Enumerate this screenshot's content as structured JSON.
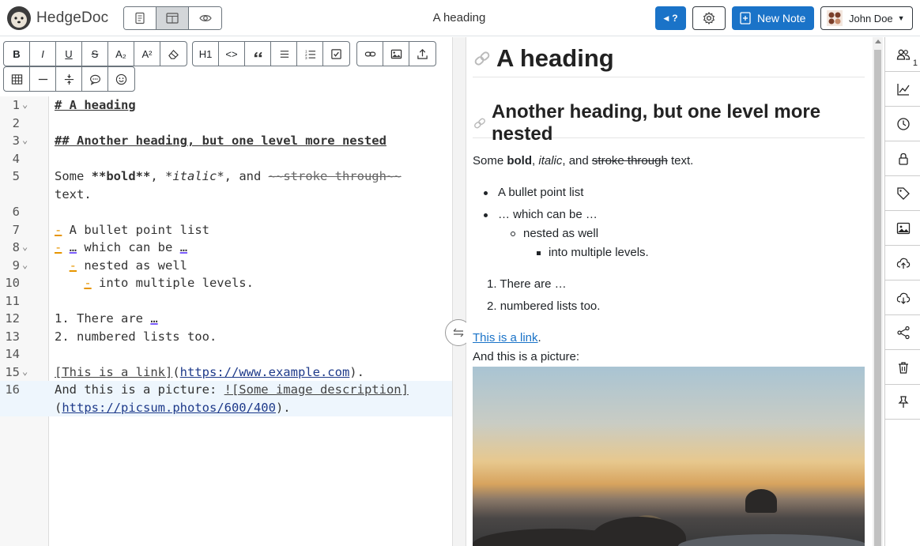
{
  "app": {
    "brand": "HedgeDoc",
    "note_title": "A heading"
  },
  "header": {
    "view_modes": [
      {
        "name": "editor",
        "icon": "file-text-icon",
        "active": false
      },
      {
        "name": "split",
        "icon": "split-view-icon",
        "active": true
      },
      {
        "name": "preview",
        "icon": "eye-icon",
        "active": false
      }
    ],
    "help_label": "?",
    "new_note_label": "New Note",
    "user_name": "John Doe"
  },
  "toolbar": {
    "row1": [
      [
        "B",
        "I",
        "U",
        "S",
        "A₂",
        "A²",
        "eraser"
      ],
      [
        "H1",
        "<>",
        "quote",
        "list",
        "ordered-list",
        "checklist"
      ],
      [
        "link",
        "image",
        "upload"
      ]
    ],
    "row2": [
      [
        "table",
        "horizontal-rule",
        "collapsible",
        "comment",
        "emoji"
      ]
    ],
    "labels": {
      "bold": "B",
      "italic": "I",
      "underline": "U",
      "strike": "S",
      "subscript": "A₂",
      "superscript": "A²",
      "h1": "H1",
      "code": "<>"
    }
  },
  "editor": {
    "lines": [
      {
        "n": "1",
        "fold": true
      },
      {
        "n": "2",
        "fold": false
      },
      {
        "n": "3",
        "fold": true
      },
      {
        "n": "4",
        "fold": false
      },
      {
        "n": "5",
        "fold": false
      },
      {
        "n": "6",
        "fold": false
      },
      {
        "n": "7",
        "fold": false
      },
      {
        "n": "8",
        "fold": true
      },
      {
        "n": "9",
        "fold": true
      },
      {
        "n": "10",
        "fold": false
      },
      {
        "n": "11",
        "fold": false
      },
      {
        "n": "12",
        "fold": false
      },
      {
        "n": "13",
        "fold": false
      },
      {
        "n": "14",
        "fold": false
      },
      {
        "n": "15",
        "fold": true
      },
      {
        "n": "16",
        "fold": false
      }
    ],
    "text": {
      "l1": "# A heading",
      "l3": "## Another heading, but one level more nested",
      "l5a": "Some ",
      "l5b": "**bold**",
      "l5c": ", ",
      "l5d": "*italic*",
      "l5e": ", and ",
      "l5f": "~~stroke through~~",
      "l5g": "text.",
      "l7a": "-",
      "l7b": " A bullet point list",
      "l8a": "-",
      "l8b": "…",
      "l8c": " which can be ",
      "l8d": "…",
      "l9a": "-",
      "l9b": " nested as well",
      "l10a": "-",
      "l10b": " into multiple levels.",
      "l12a": "1. There are ",
      "l12b": "…",
      "l13": "2. numbered lists too.",
      "l15a": "[This is a link]",
      "l15b": "(",
      "l15c": "https://www.example.com",
      "l15d": ").",
      "l16a": "And this is a picture: ",
      "l16b": "![Some image description]",
      "l16c": "(",
      "l16d": "https://picsum.photos/600/400",
      "l16e": ")."
    }
  },
  "preview": {
    "h1": "A heading",
    "h2": "Another heading, but one level more nested",
    "p1": {
      "a": "Some ",
      "bold": "bold",
      "b": ", ",
      "italic": "italic",
      "c": ", and ",
      "strike": "stroke through",
      "d": " text."
    },
    "bullets": [
      "A bullet point list",
      "… which can be …",
      "nested as well",
      "into multiple levels."
    ],
    "numbered": [
      {
        "n": "1.",
        "text": "There are …"
      },
      {
        "n": "2.",
        "text": "numbered lists too."
      }
    ],
    "link_text": "This is a link",
    "link_after": ".",
    "picture_caption": "And this is a picture:"
  },
  "sidebar": {
    "items": [
      "users-icon",
      "chart-icon",
      "history-icon",
      "lock-icon",
      "tag-icon",
      "image-icon",
      "cloud-upload-icon",
      "cloud-download-icon",
      "share-icon",
      "trash-icon",
      "pin-icon"
    ],
    "online_count": "1"
  },
  "colors": {
    "primary": "#1a73c8",
    "accent_orange": "#e69500",
    "accent_purple": "#7b5cff",
    "link": "#1a73c8"
  }
}
